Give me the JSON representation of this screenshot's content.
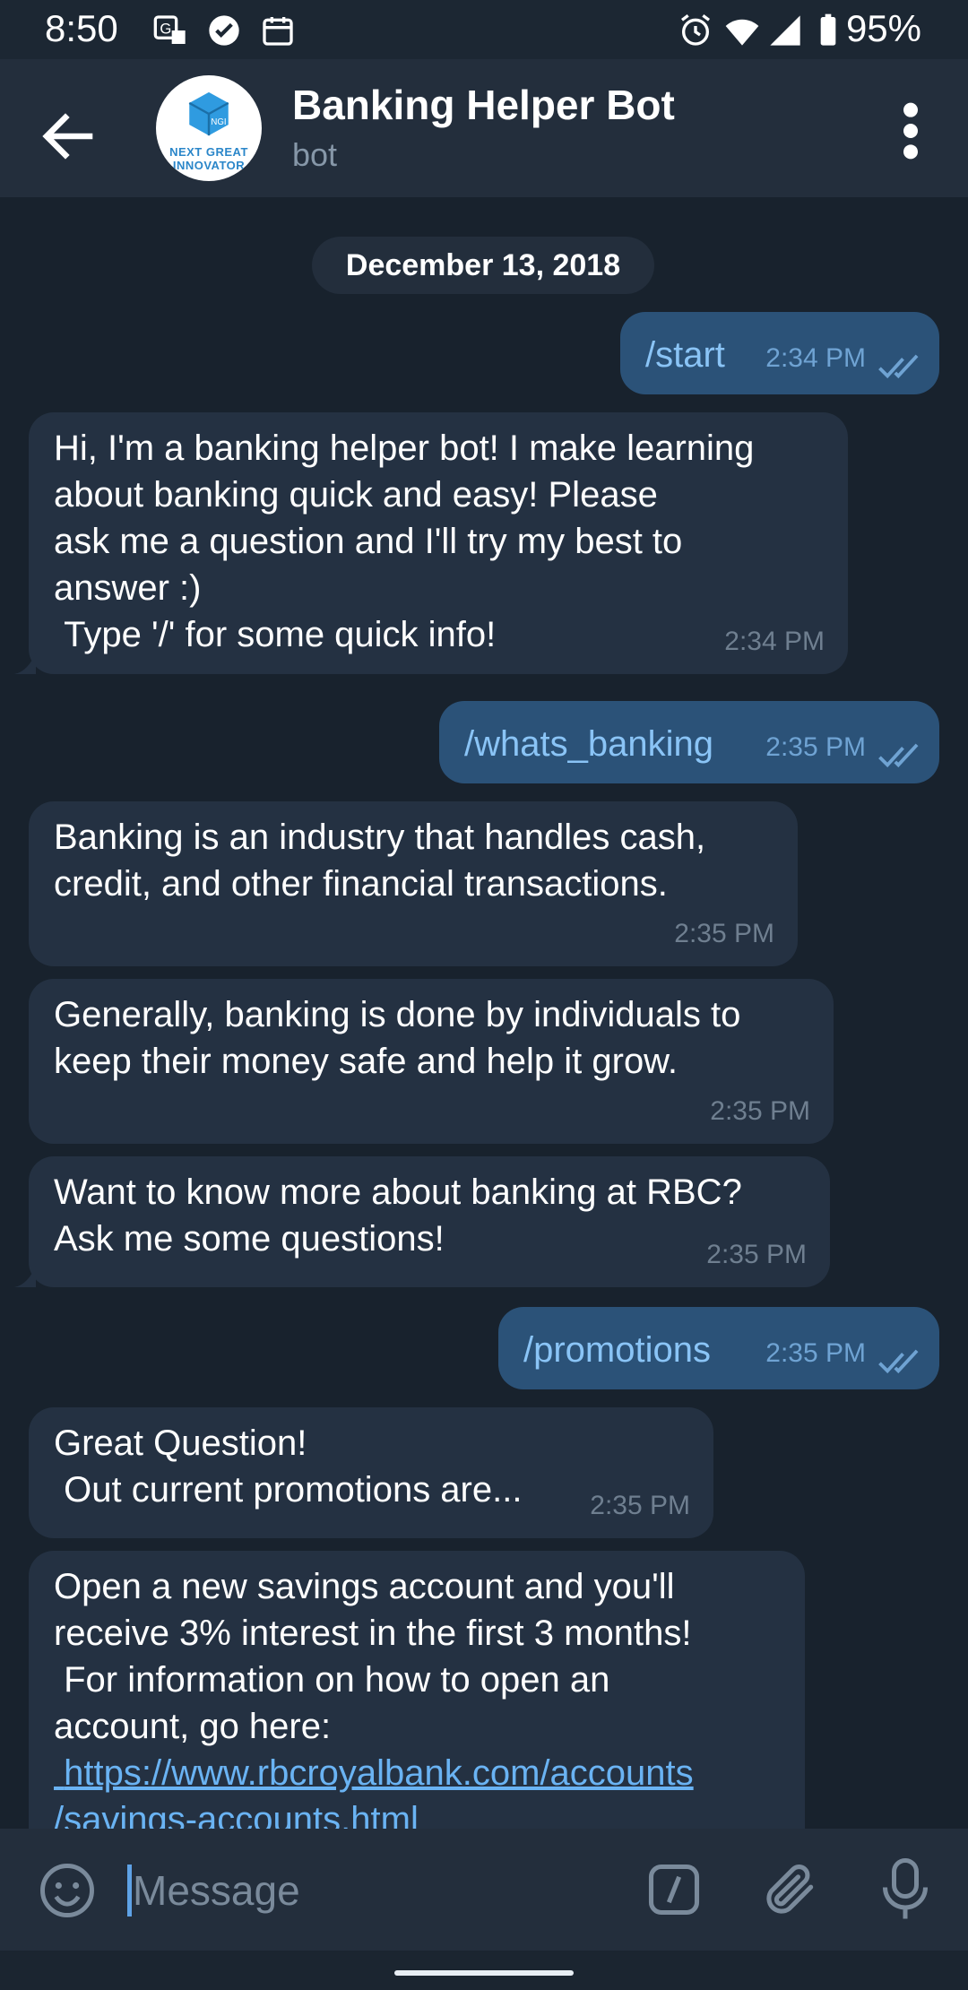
{
  "status_bar": {
    "time": "8:50",
    "battery": "95%",
    "icons": [
      "translate-icon",
      "check-circle-icon",
      "calendar-icon",
      "alarm-icon",
      "wifi-icon",
      "signal-icon",
      "battery-icon"
    ]
  },
  "header": {
    "title": "Banking Helper Bot",
    "subtitle": "bot",
    "avatar_text": "NEXT GREAT\nINNOVATOR",
    "avatar_badge": "NGI"
  },
  "date_separator": "December 13, 2018",
  "messages": [
    {
      "direction": "out",
      "text": "/start",
      "time": "2:34 PM"
    },
    {
      "direction": "in",
      "text": "Hi, I'm a banking helper bot! I make learning\nabout banking quick and easy! Please\nask me a question and I'll try my best to\nanswer :)\n Type '/' for some quick info!",
      "time": "2:34 PM"
    },
    {
      "direction": "out",
      "text": "/whats_banking",
      "time": "2:35 PM"
    },
    {
      "direction": "in",
      "text": "Banking is an industry that handles cash,\ncredit, and other financial transactions.",
      "time": "2:35 PM"
    },
    {
      "direction": "in",
      "text": "Generally, banking is done by individuals to\nkeep their money safe and help it grow.",
      "time": "2:35 PM"
    },
    {
      "direction": "in",
      "text": "Want to know more about banking at RBC?\nAsk me some questions!",
      "time": "2:35 PM"
    },
    {
      "direction": "out",
      "text": "/promotions",
      "time": "2:35 PM"
    },
    {
      "direction": "in",
      "text": "Great Question!\n Out current promotions are...",
      "time": "2:35 PM"
    },
    {
      "direction": "in",
      "text": "Open a new savings account and you'll\nreceive 3% interest in the first 3 months!\n For information on how to open an\naccount, go here:",
      "link": " https://www.rbcroyalbank.com/accounts\n/savings-accounts.html"
    }
  ],
  "composer": {
    "placeholder": "Message"
  },
  "colors": {
    "background": "#18222d",
    "header": "#232e3c",
    "incoming_bubble": "#243142",
    "outgoing_bubble": "#2b5278",
    "link": "#6ab3f3"
  }
}
